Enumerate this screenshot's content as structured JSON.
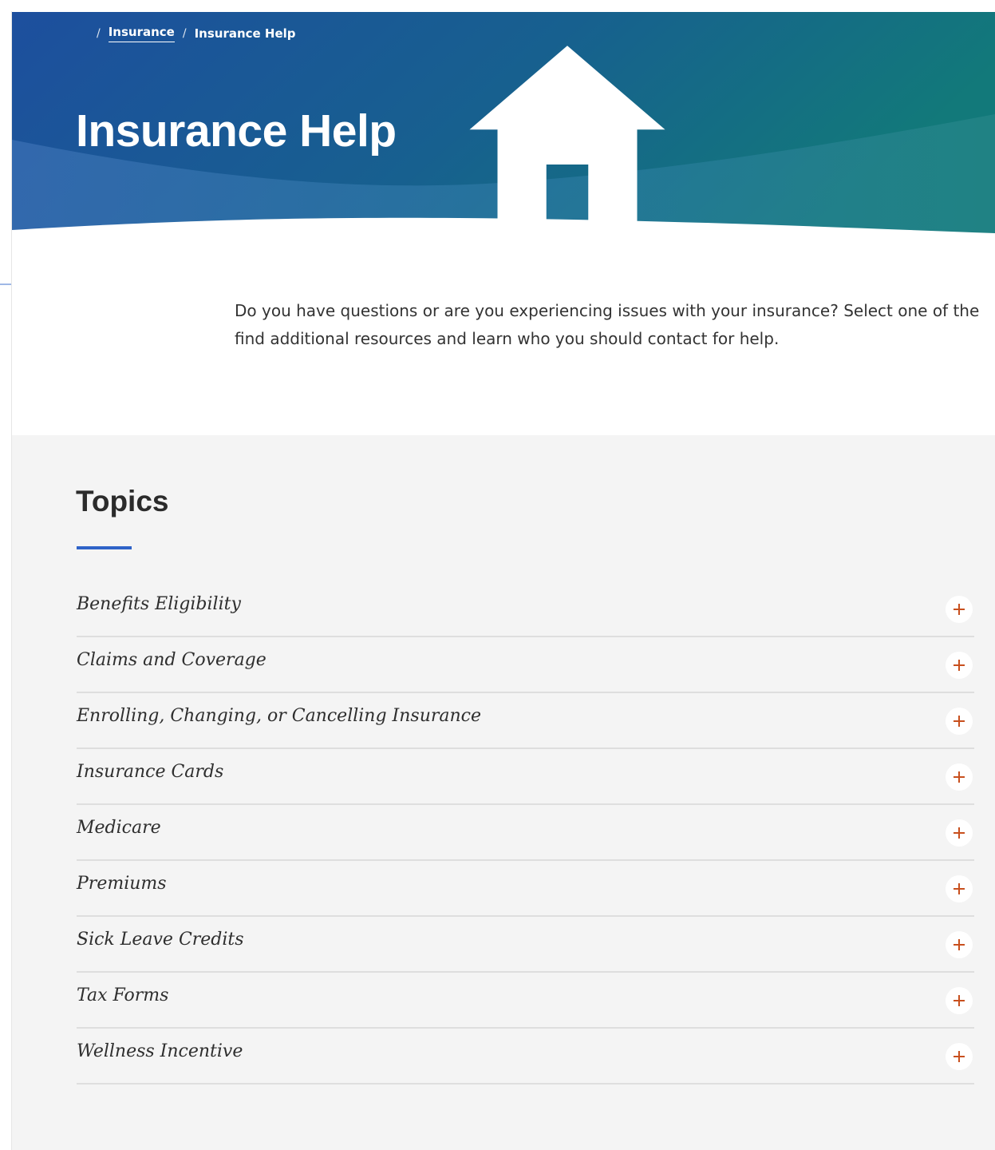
{
  "breadcrumb": {
    "home_icon": "home-icon",
    "separator": "/",
    "items": [
      {
        "label": "Insurance",
        "is_link": true
      },
      {
        "label": "Insurance Help",
        "is_link": false
      }
    ]
  },
  "hero": {
    "title": "Insurance Help",
    "gradient_colors": [
      "#1d4f9e",
      "#12767b"
    ]
  },
  "intro": {
    "line1": "Do you have questions or are you experiencing issues with your insurance? Select one of the",
    "line2": "find additional resources and learn who you should contact for help."
  },
  "topics": {
    "title": "Topics",
    "accent_color": "#2f63c8",
    "expand_icon": "plus-icon",
    "expand_icon_color": "#c8501e",
    "items": [
      {
        "label": "Benefits Eligibility"
      },
      {
        "label": "Claims and Coverage"
      },
      {
        "label": "Enrolling, Changing, or Cancelling Insurance"
      },
      {
        "label": "Insurance Cards"
      },
      {
        "label": "Medicare"
      },
      {
        "label": "Premiums"
      },
      {
        "label": "Sick Leave Credits"
      },
      {
        "label": "Tax Forms"
      },
      {
        "label": "Wellness Incentive"
      }
    ]
  }
}
